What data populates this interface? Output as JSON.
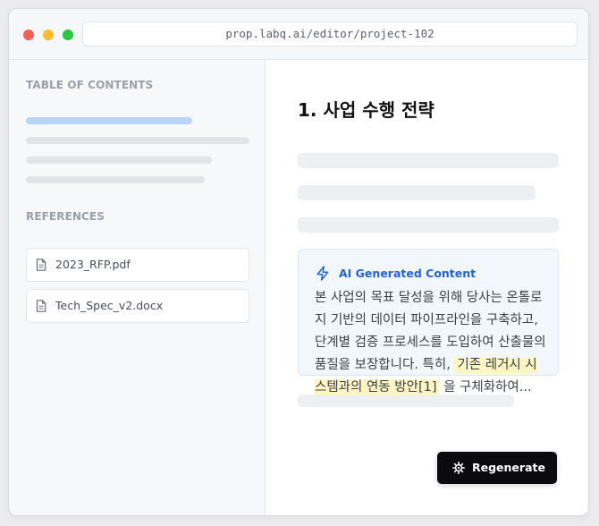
{
  "browser": {
    "url": "prop.labq.ai/editor/project-102"
  },
  "sidebar": {
    "toc_title": "TABLE OF CONTENTS",
    "references_title": "REFERENCES",
    "references": [
      {
        "label": "2023_RFP.pdf",
        "icon": "file-icon"
      },
      {
        "label": "Tech_Spec_v2.docx",
        "icon": "file-icon"
      }
    ]
  },
  "main": {
    "heading": "1. 사업 수행 전략",
    "ai_card": {
      "title": "AI Generated Content",
      "icon": "lightning-icon",
      "text_before": "본 사업의 목표 달성을 위해 당사는 온톨로지 기반의 데이터 파이프라인을 구축하고, 단계별 검증 프로세스를 도입하여 산출물의 품질을 보장합니다. 특히, ",
      "highlight": "기존 레거시 시스템과의 연동 방안[1]",
      "text_after": " 을 구체화하여..."
    },
    "regenerate_label": "Regenerate",
    "regenerate_icon": "gear-icon"
  },
  "colors": {
    "accent": "#2563d4",
    "highlight": "#fdf6c3",
    "toc_active": "#b8d4f8",
    "button_bg": "#0b0b0d"
  }
}
